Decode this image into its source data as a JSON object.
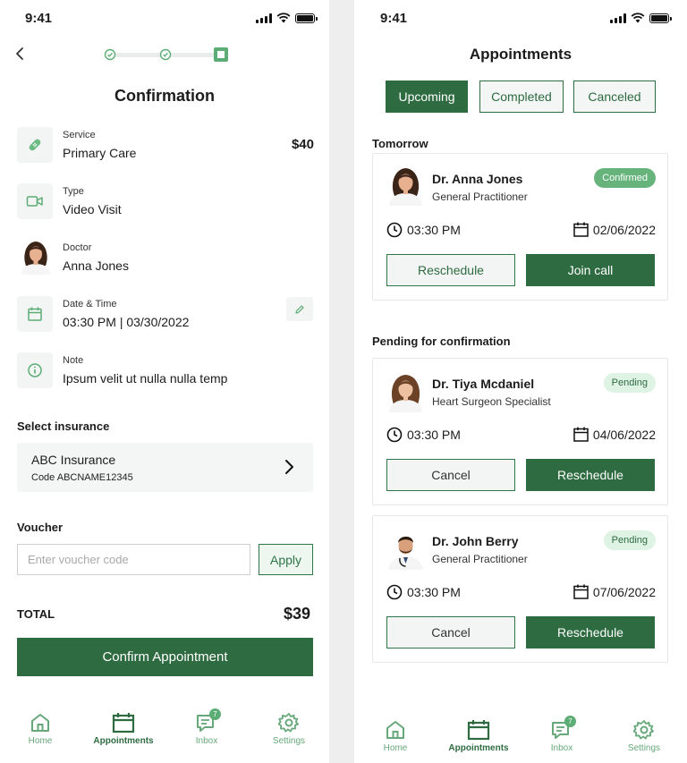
{
  "colors": {
    "primary": "#2e6b41",
    "accent": "#5cad75",
    "light": "#dff3e5"
  },
  "left": {
    "status_time": "9:41",
    "title": "Confirmation",
    "progress": {
      "completed_steps": 2,
      "total_steps": 3
    },
    "rows": {
      "service": {
        "label": "Service",
        "value": "Primary Care",
        "price": "$40",
        "icon": "bandage-icon"
      },
      "type": {
        "label": "Type",
        "value": "Video Visit",
        "icon": "video-icon"
      },
      "doctor": {
        "label": "Doctor",
        "value": "Anna Jones"
      },
      "datetime": {
        "label": "Date & Time",
        "value": "03:30 PM | 03/30/2022",
        "icon": "calendar-icon"
      },
      "note": {
        "label": "Note",
        "value": "Ipsum velit ut nulla nulla temp",
        "icon": "info-icon"
      }
    },
    "insurance": {
      "section_title": "Select insurance",
      "name": "ABC Insurance",
      "code": "Code ABCNAME12345"
    },
    "voucher": {
      "section_title": "Voucher",
      "placeholder": "Enter voucher code",
      "value": "",
      "apply_label": "Apply"
    },
    "total": {
      "label": "TOTAL",
      "value": "$39"
    },
    "confirm_label": "Confirm Appointment"
  },
  "right": {
    "status_time": "9:41",
    "title": "Appointments",
    "tabs": [
      {
        "label": "Upcoming",
        "active": true
      },
      {
        "label": "Completed",
        "active": false
      },
      {
        "label": "Canceled",
        "active": false
      }
    ],
    "groups": {
      "tomorrow": "Tomorrow",
      "pending": "Pending for confirmation"
    },
    "cards": [
      {
        "name": "Dr. Anna Jones",
        "role": "General Practitioner",
        "status": "Confirmed",
        "time": "03:30 PM",
        "date": "02/06/2022",
        "secondary": "Reschedule",
        "primary": "Join call"
      },
      {
        "name": "Dr. Tiya Mcdaniel",
        "role": "Heart Surgeon Specialist",
        "status": "Pending",
        "time": "03:30 PM",
        "date": "04/06/2022",
        "secondary": "Cancel",
        "primary": "Reschedule"
      },
      {
        "name": "Dr. John Berry",
        "role": "General Practitioner",
        "status": "Pending",
        "time": "03:30 PM",
        "date": "07/06/2022",
        "secondary": "Cancel",
        "primary": "Reschedule"
      }
    ]
  },
  "nav": {
    "items": [
      {
        "label": "Home",
        "icon": "home-icon"
      },
      {
        "label": "Appointments",
        "icon": "calendar-icon",
        "active": true
      },
      {
        "label": "Inbox",
        "icon": "chat-icon",
        "badge": "7"
      },
      {
        "label": "Settings",
        "icon": "gear-icon"
      }
    ]
  }
}
